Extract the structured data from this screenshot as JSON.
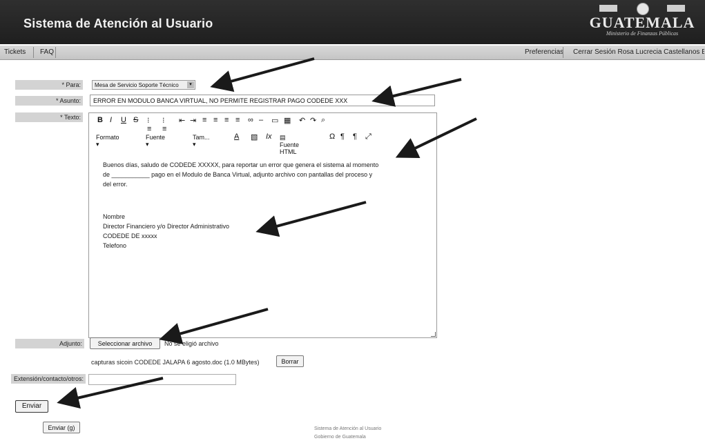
{
  "header": {
    "app_title": "Sistema de Atención al Usuario",
    "logo": {
      "line1": "",
      "line2": "GUATEMALA",
      "line3": "Ministerio de Finanzas Públicas"
    }
  },
  "nav": {
    "left": [
      "Tickets",
      "FAQ"
    ],
    "right": [
      "Preferencias",
      "Cerrar Sesión Rosa Lucrecia Castellanos Bence"
    ]
  },
  "form": {
    "para_label": "* Para:",
    "para_value": "Mesa de Servicio Soporte Técnico",
    "asunto_label": "* Asunto:",
    "asunto_value": "ERROR EN MODULO BANCA VIRTUAL, NO PERMITE REGISTRAR PAGO CODEDE XXX",
    "texto_label": "* Texto:",
    "editor": {
      "toolbar_format": "Formato",
      "toolbar_font": "Fuente",
      "toolbar_size": "Tam...",
      "toolbar_source": "Fuente HTML",
      "body_line1": "Buenos días, saludo de CODEDE XXXXX, para reportar un error que genera el sistema al momento",
      "body_line2": "de ___________ pago en el Modulo de Banca Virtual, adjunto archivo con pantallas del proceso y",
      "body_line3": "del error.",
      "sig_name": "Nombre",
      "sig_title": "Director Financiero y/o Director Administrativo",
      "sig_org": "CODEDE DE xxxxx",
      "sig_phone": "Telefono"
    },
    "adjunto_label": "Adjunto:",
    "file_button": "Seleccionar archivo",
    "file_status": "No se eligió archivo",
    "attached_file": "capturas sicoin CODEDE JALAPA 6 agosto.doc (1.0 MBytes)",
    "delete_button": "Borrar",
    "extension_label": "Extensión/contacto/otros:",
    "send_button": "Enviar",
    "send_shortcut_button": "Enviar (g)"
  },
  "footer": {
    "line1": "Sistema de Atención al Usuario",
    "line2": "Gobierno de Guatemala"
  },
  "colors": {
    "header_bg": "#262626",
    "navbar_bg": "#cfcfcf",
    "arrow": "#1a1a1a"
  }
}
